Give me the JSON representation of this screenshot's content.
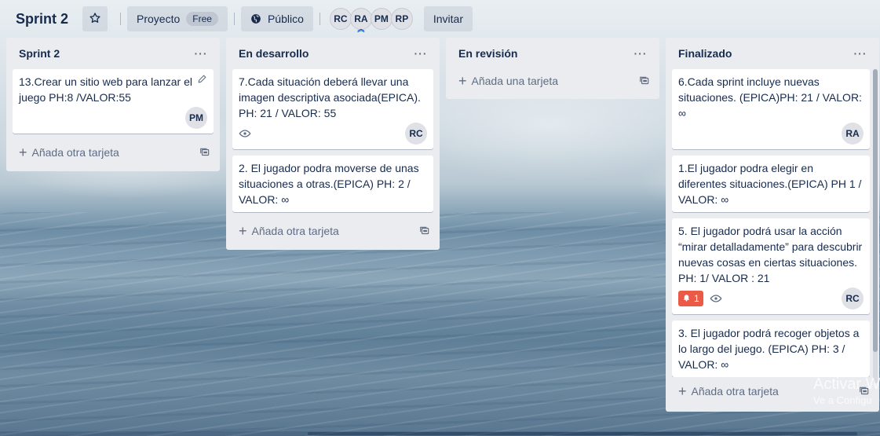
{
  "board": {
    "title": "Sprint 2",
    "workspace_label": "Proyecto",
    "workspace_badge": "Free",
    "visibility_label": "Público",
    "members": [
      "RC",
      "RA",
      "PM",
      "RP"
    ],
    "invite_label": "Invitar"
  },
  "lists": [
    {
      "title": "Sprint 2",
      "cards": [
        {
          "text": "13.Crear un sitio web para lanzar el juego PH:8 /VALOR:55",
          "member": "PM"
        }
      ],
      "add_label": "Añada otra tarjeta"
    },
    {
      "title": "En desarrollo",
      "cards": [
        {
          "text": "7.Cada situación deberá llevar una imagen descriptiva asociada(EPICA). PH: 21 / VALOR: 55",
          "member": "RC",
          "watching": true
        },
        {
          "text": "2. El jugador podra moverse de unas situaciones a otras.(EPICA) PH: 2 / VALOR: ∞"
        }
      ],
      "add_label": "Añada otra tarjeta"
    },
    {
      "title": "En revisión",
      "cards": [],
      "add_label": "Añada una tarjeta"
    },
    {
      "title": "Finalizado",
      "cards": [
        {
          "text": "6.Cada sprint incluye nuevas situaciones. (EPICA)PH: 21 / VALOR: ∞",
          "member": "RA"
        },
        {
          "text": "1.El jugador podra elegir en diferentes situaciones.(EPICA) PH 1 / VALOR: ∞"
        },
        {
          "text": "5. El jugador podrá usar la acción “mirar detalladamente” para descubrir nuevas cosas en ciertas situaciones. PH: 1/ VALOR : 21",
          "member": "RC",
          "due_count": "1",
          "watching": true
        },
        {
          "text": "3. El jugador podrá recoger objetos a lo largo del juego. (EPICA) PH: 3 / VALOR: ∞"
        }
      ],
      "add_label": "Añada otra tarjeta"
    }
  ],
  "list_menu_glyph": "···",
  "plus_glyph": "+",
  "watermark": {
    "title": "Activar W",
    "subtitle": "Ve a Configu"
  },
  "colors": {
    "due_badge": "#eb5a46",
    "list_bg": "#ebecf0",
    "text": "#172b4d"
  },
  "icons": {
    "star": "star-icon",
    "globe": "globe-icon",
    "menu": "ellipsis-icon",
    "add": "plus-icon",
    "template": "card-template-icon",
    "watch": "eye-icon",
    "due": "bell-icon",
    "edit": "pencil-icon"
  }
}
